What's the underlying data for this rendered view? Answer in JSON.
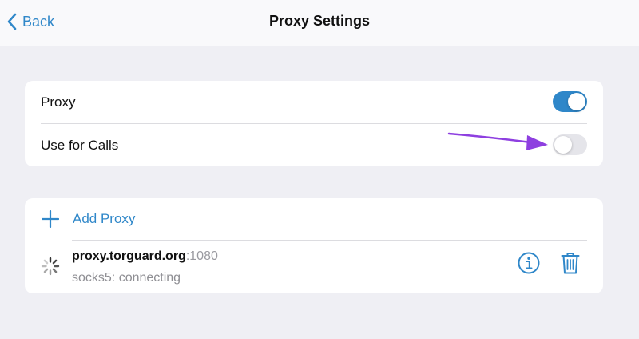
{
  "nav": {
    "back_label": "Back",
    "title": "Proxy Settings"
  },
  "settings": {
    "proxy_label": "Proxy",
    "proxy_enabled": true,
    "calls_label": "Use for Calls",
    "calls_enabled": false
  },
  "proxies": {
    "add_label": "Add Proxy",
    "items": [
      {
        "server": "proxy.torguard.org",
        "port": ":1080",
        "status": "socks5: connecting"
      }
    ]
  },
  "colors": {
    "accent": "#2f87c9",
    "annotation_arrow": "#8e3fe0",
    "background": "#efeff4"
  },
  "icons": {
    "back": "chevron-left-icon",
    "add": "plus-icon",
    "loading": "spinner-icon",
    "info": "info-icon",
    "delete": "trash-icon"
  }
}
